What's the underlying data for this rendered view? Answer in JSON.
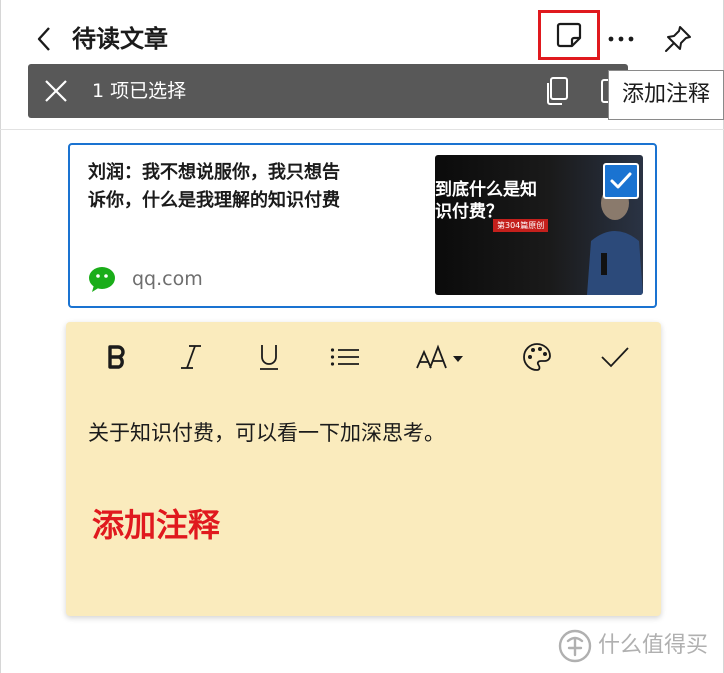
{
  "header": {
    "title": "待读文章"
  },
  "selection_bar": {
    "count_text": "1 项已选择"
  },
  "tooltip": {
    "text": "添加注释"
  },
  "article": {
    "headline_line1": "刘润：我不想说服你，我只想告",
    "headline_line2": "诉你，什么是我理解的知识付费",
    "source": "qq.com",
    "selected": true,
    "thumbnail": {
      "line1": "到底什么是知",
      "line2": "识付费？",
      "badge": "第304篇原创"
    }
  },
  "note": {
    "toolbar": [
      "bold-icon",
      "italic-icon",
      "underline-icon",
      "list-icon",
      "font-size-icon",
      "palette-icon",
      "check-icon"
    ],
    "body_text": "关于知识付费，可以看一下加深思考。",
    "annotation": "添加注释",
    "background": "#faebbd"
  },
  "watermark": {
    "text": "什么值得买"
  },
  "colors": {
    "accent_blue": "#1a73d1",
    "highlight_red": "#e0191e",
    "selection_bar": "#585858"
  }
}
